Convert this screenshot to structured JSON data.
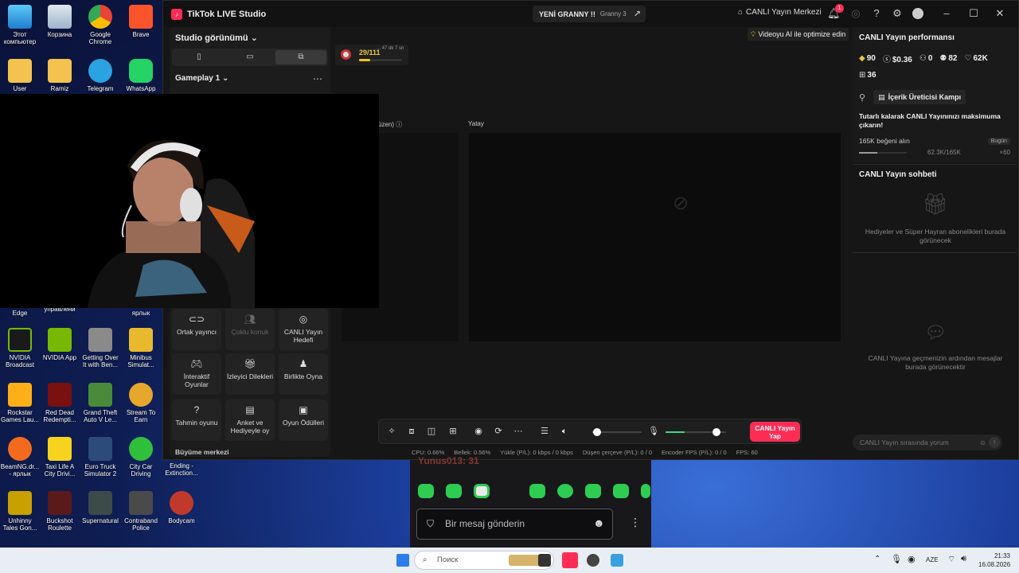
{
  "desktop": {
    "icons": [
      {
        "label": "Этот компьютер"
      },
      {
        "label": "Корзина"
      },
      {
        "label": "Google Chrome"
      },
      {
        "label": "Brave"
      },
      {
        "label": "User"
      },
      {
        "label": "Ramiz"
      },
      {
        "label": "Telegram"
      },
      {
        "label": "WhatsApp"
      },
      {
        "label": "Edge"
      },
      {
        "label": "управлени"
      },
      {
        "label": "ярлык"
      },
      {
        "label": "NVIDIA Broadcast"
      },
      {
        "label": "NVIDIA App"
      },
      {
        "label": "Getting Over It with Ben..."
      },
      {
        "label": "Minibus Simulat..."
      },
      {
        "label": "Rockstar Games Lau..."
      },
      {
        "label": "Red Dead Redempti..."
      },
      {
        "label": "Grand Theft Auto V Le..."
      },
      {
        "label": "Stream To Earn"
      },
      {
        "label": "BeamNG.dr... - ярлык"
      },
      {
        "label": "Taxi Life A City Drivi..."
      },
      {
        "label": "Euro Truck Simulator 2"
      },
      {
        "label": "City Car Driving"
      },
      {
        "label": "Ending - Extinction..."
      },
      {
        "label": "Unhinny Tales Gon..."
      },
      {
        "label": "Buckshot Roulette"
      },
      {
        "label": "Supernatural"
      },
      {
        "label": "Contraband Police"
      },
      {
        "label": "Bodycam"
      }
    ]
  },
  "studio": {
    "app_title": "TikTok LIVE Studio",
    "game_pill": {
      "title": "YENİ GRANNY !!",
      "subtitle": "Granny 3"
    },
    "live_center": "CANLI Yayın Merkezi",
    "notification_count": "1",
    "left_panel": {
      "view_title": "Studio görünümü",
      "scene_name": "Gameplay 1",
      "tools": [
        {
          "label": "Ortak yayıncı"
        },
        {
          "label": "Çoklu konuk"
        },
        {
          "label": "CANLI Yayın Hedefi"
        },
        {
          "label": "İnteraktif Oyunlar"
        },
        {
          "label": "İzleyici Dilekleri"
        },
        {
          "label": "Birlikte Oyna"
        },
        {
          "label": "Tahmin oyunu"
        },
        {
          "label": "Anket ve Hediyeyle oy"
        },
        {
          "label": "Oyun Ödülleri"
        }
      ],
      "growth": "Büyüme merkezi"
    },
    "preview": {
      "goal_count": "29/111",
      "goal_time": "... 47 dk 7 sn",
      "goal_progress": 0.26,
      "ai_tip": "Videoyu AI ile optimize edin",
      "vertical_label": "üzen)",
      "horizontal_label": "Yatay"
    },
    "toolbar": {
      "go_live": "CANLI Yayın Yap",
      "volume_level": 0.09,
      "mic_level": 0.32,
      "mic_gain": 0.84
    },
    "stats": {
      "cpu": "CPU:  0.66%",
      "memory": "Bellek:  0.56%",
      "upload": "Yükle (P/L):  0 kbps / 0 kbps",
      "dropped": "Düşen çerçeve (P/L):  0 / 0",
      "encoder": "Encoder FPS (P/L):  0 / 0",
      "fps": "FPS:  60"
    },
    "right_panel": {
      "performance_title": "CANLI Yayın performansı",
      "metrics": {
        "diamonds": "90",
        "earnings": "$0.36",
        "viewers": "0",
        "followers": "82",
        "likes": "62K",
        "gifts": "36"
      },
      "creator_camp": "İçerik Üreticisi Kampı",
      "consistency_title": "Tutarlı kalarak CANLI Yayınınızı maksimuma çıkarın!",
      "likes_goal": "165K beğeni alın",
      "today_badge": "Bugün",
      "likes_progress": "62.3K/165K",
      "likes_fraction": 0.38,
      "reward": "×60",
      "chat_title": "CANLI Yayın sohbeti",
      "gifts_empty": "Hediyeler ve Süper Hayran abonelikleri burada görünecek",
      "chat_empty": "CANLI Yayına geçmenizin ardından mesajlar burada görünecektir",
      "chat_placeholder": "CANLI Yayın sırasında yorum"
    }
  },
  "chat_overlay": {
    "partial_name": "Yunus013: 31",
    "placeholder": "Bir mesaj gönderin"
  },
  "taskbar": {
    "search_placeholder": "Поиск",
    "language": "AZE",
    "time": "21:33",
    "date": "16.08.2026"
  }
}
